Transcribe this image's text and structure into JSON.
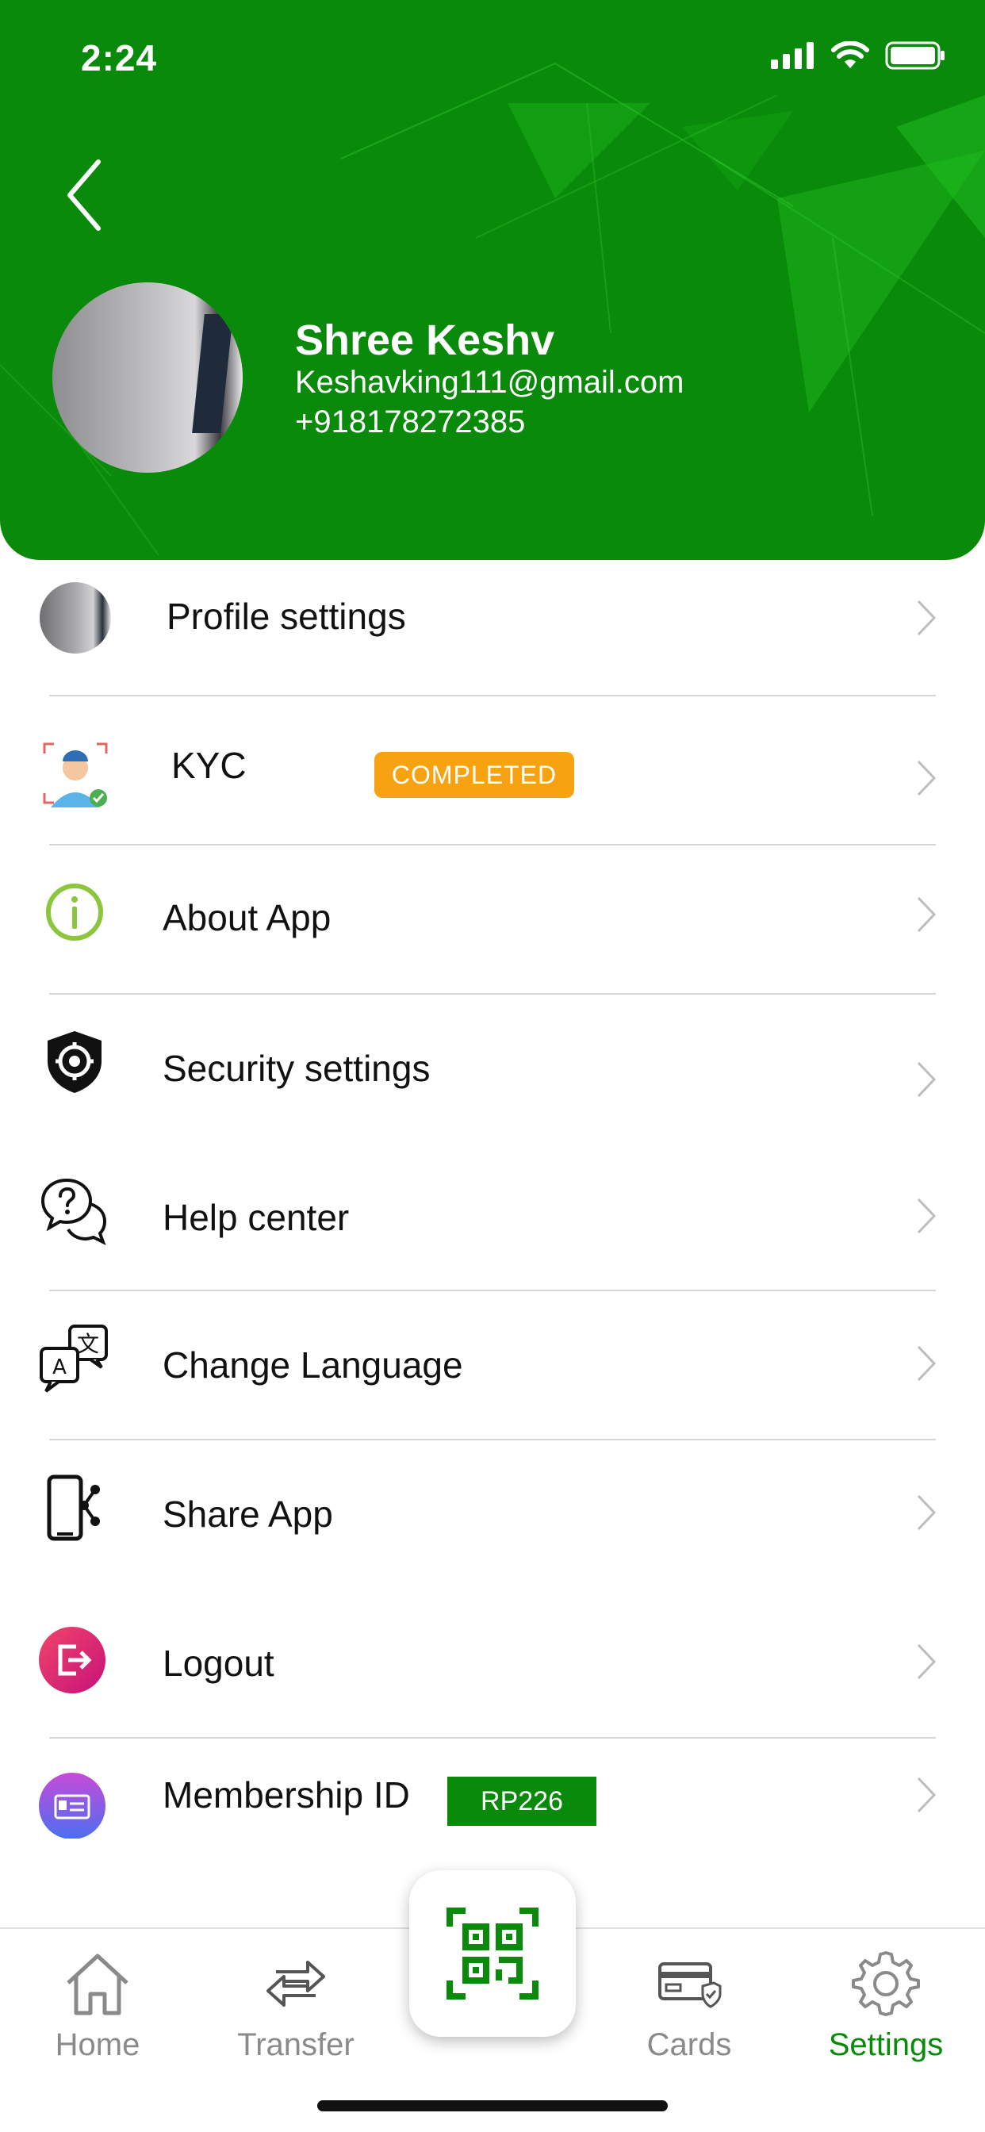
{
  "status_bar": {
    "time": "2:24"
  },
  "profile": {
    "name": "Shree Keshv",
    "email": "Keshavking111@gmail.com",
    "phone": "+918178272385"
  },
  "menu": {
    "items": [
      {
        "label": "Profile settings",
        "icon": "profile-photo"
      },
      {
        "label": "KYC",
        "icon": "kyc-face-icon",
        "badge": "COMPLETED"
      },
      {
        "label": "About App",
        "icon": "info-icon"
      },
      {
        "label": "Security settings",
        "icon": "shield-gear-icon"
      },
      {
        "label": "Help center",
        "icon": "help-chat-icon"
      },
      {
        "label": "Change Language",
        "icon": "translate-icon"
      },
      {
        "label": "Share App",
        "icon": "share-phone-icon"
      },
      {
        "label": "Logout",
        "icon": "logout-icon"
      },
      {
        "label": "Membership ID",
        "icon": "id-card-icon",
        "badge": "RP226"
      }
    ]
  },
  "tabbar": {
    "tabs": [
      {
        "label": "Home",
        "icon": "home-icon"
      },
      {
        "label": "Transfer",
        "icon": "transfer-icon"
      },
      {
        "label": "",
        "icon": "qr-scan-icon"
      },
      {
        "label": "Cards",
        "icon": "cards-icon"
      },
      {
        "label": "Settings",
        "icon": "settings-icon",
        "active": true
      }
    ]
  },
  "colors": {
    "brand_green": "#0a8a0a",
    "badge_orange": "#f7a311",
    "chevron_gray": "#bdbdbd",
    "tab_inactive": "#8a8a8a"
  }
}
